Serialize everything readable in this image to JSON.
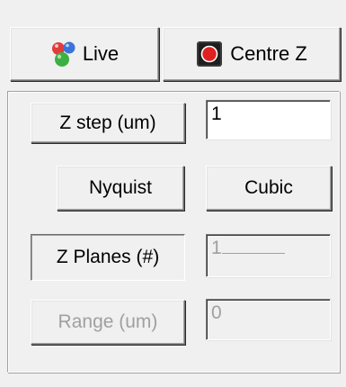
{
  "toolbar": {
    "live_label": "Live",
    "live_icon": "molecule-balls-icon",
    "centre_label": "Centre Z",
    "centre_icon": "record-stop-icon"
  },
  "zstep": {
    "button_label": "Z step (um)",
    "value": "1"
  },
  "sampling": {
    "nyquist_label": "Nyquist",
    "cubic_label": "Cubic"
  },
  "zplanes": {
    "button_label": "Z Planes (#)",
    "value": "1"
  },
  "range": {
    "button_label": "Range (um)",
    "value": "0"
  },
  "colors": {
    "face": "#f0f0f0",
    "disabled_text": "#a0a0a0",
    "stop_red": "#e02020",
    "ball_red": "#e23b3b",
    "ball_green": "#3cb043",
    "ball_blue": "#3a74d8"
  }
}
